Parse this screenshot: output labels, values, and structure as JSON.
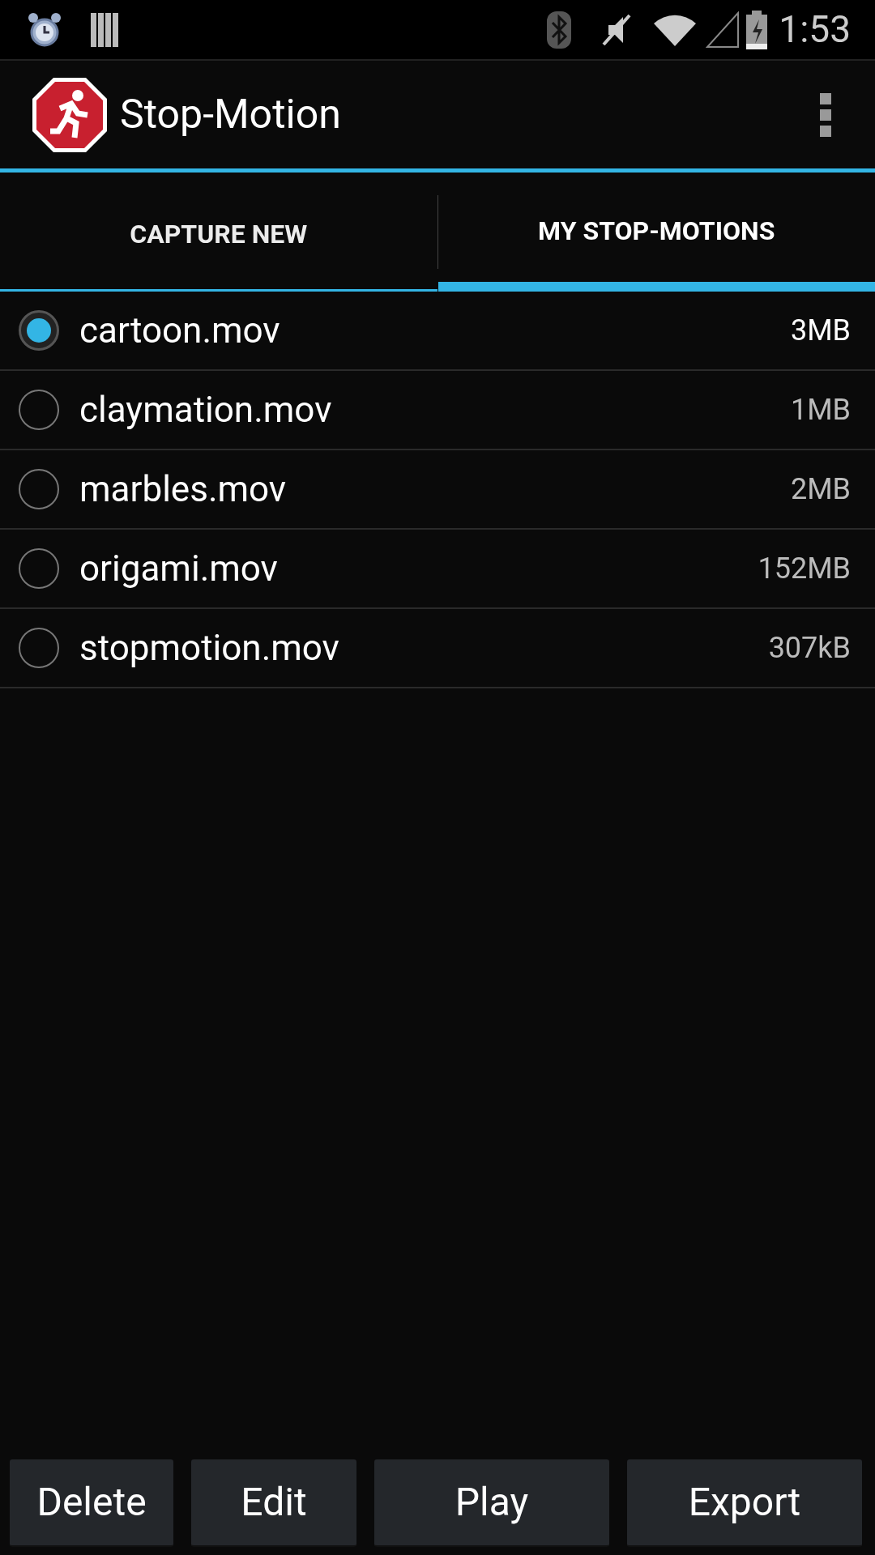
{
  "status_bar": {
    "time": "1:53"
  },
  "app_bar": {
    "title": "Stop-Motion"
  },
  "tabs": [
    {
      "label": "CAPTURE NEW",
      "selected": false
    },
    {
      "label": "MY STOP-MOTIONS",
      "selected": true
    }
  ],
  "files": [
    {
      "name": "cartoon.mov",
      "size": "3MB",
      "selected": true
    },
    {
      "name": "claymation.mov",
      "size": "1MB",
      "selected": false
    },
    {
      "name": "marbles.mov",
      "size": "2MB",
      "selected": false
    },
    {
      "name": "origami.mov",
      "size": "152MB",
      "selected": false
    },
    {
      "name": "stopmotion.mov",
      "size": "307kB",
      "selected": false
    }
  ],
  "buttons": [
    {
      "label": "Delete"
    },
    {
      "label": "Edit"
    },
    {
      "label": "Play"
    },
    {
      "label": "Export"
    }
  ]
}
